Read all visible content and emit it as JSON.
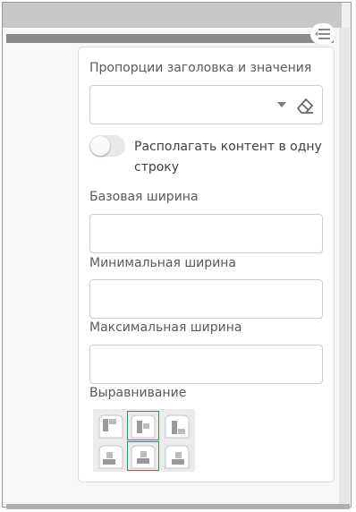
{
  "panel": {
    "proportions_label": "Пропорции заголовка и значения",
    "proportions_value": "",
    "single_line_toggle_label": "Располагать контент в одну строку",
    "single_line_enabled": false,
    "base_width_label": "Базовая ширина",
    "base_width_value": "",
    "min_width_label": "Минимальная ширина",
    "min_width_value": "",
    "max_width_label": "Максимальная ширина",
    "max_width_value": "",
    "alignment_label": "Выравнивание",
    "alignment_options": [
      {
        "icon": "align-top-left-icon",
        "selected": false
      },
      {
        "icon": "align-top-center-icon",
        "selected": true
      },
      {
        "icon": "align-top-right-icon",
        "selected": false
      },
      {
        "icon": "align-bottom-left-icon",
        "selected": false
      },
      {
        "icon": "align-bottom-center-icon",
        "selected": true
      },
      {
        "icon": "align-bottom-right-icon",
        "selected": false
      }
    ]
  },
  "icons": {
    "menu": "menu-icon",
    "dropdown": "chevron-down-icon",
    "clear": "eraser-icon"
  },
  "colors": {
    "selection_border": "#2e9b4a",
    "input_border": "#cfcfcf",
    "label_text": "#5a5a5a"
  }
}
